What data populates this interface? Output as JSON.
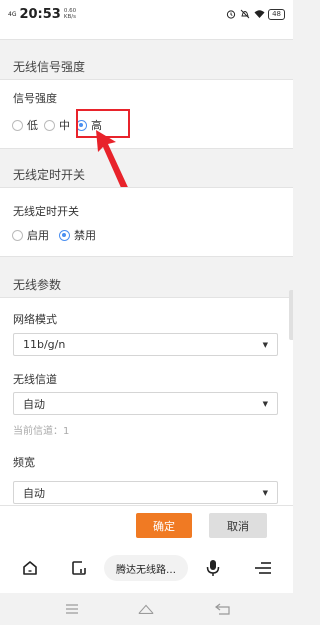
{
  "status_bar": {
    "signal": "4G",
    "time": "20:53",
    "net_speed_value": "0.60",
    "net_speed_unit": "KB/s",
    "battery": "48"
  },
  "sections": {
    "signal_strength": {
      "title": "无线信号强度",
      "label": "信号强度",
      "options": [
        "低",
        "中",
        "高"
      ],
      "selected": "高"
    },
    "wireless_timer": {
      "title": "无线定时开关",
      "label": "无线定时开关",
      "options": [
        "启用",
        "禁用"
      ],
      "selected": "禁用"
    },
    "wireless_params": {
      "title": "无线参数",
      "network_mode_label": "网络模式",
      "network_mode_value": "11b/g/n",
      "channel_label": "无线信道",
      "channel_value": "自动",
      "current_channel_hint": "当前信道：1",
      "bandwidth_label": "频宽",
      "bandwidth_value": "自动"
    }
  },
  "actions": {
    "ok_label": "确定",
    "cancel_label": "取消"
  },
  "browser": {
    "url_title": "腾达无线路…"
  },
  "colors": {
    "accent_orange": "#f07a23",
    "radio_blue": "#4a8ff0",
    "annotation_red": "#e8232b"
  },
  "icons": [
    "alarm-icon",
    "mute-icon",
    "wifi-icon",
    "home-icon",
    "tabs-icon",
    "microphone-icon",
    "menu-icon",
    "nav-menu-icon",
    "nav-home-icon",
    "nav-back-icon"
  ]
}
